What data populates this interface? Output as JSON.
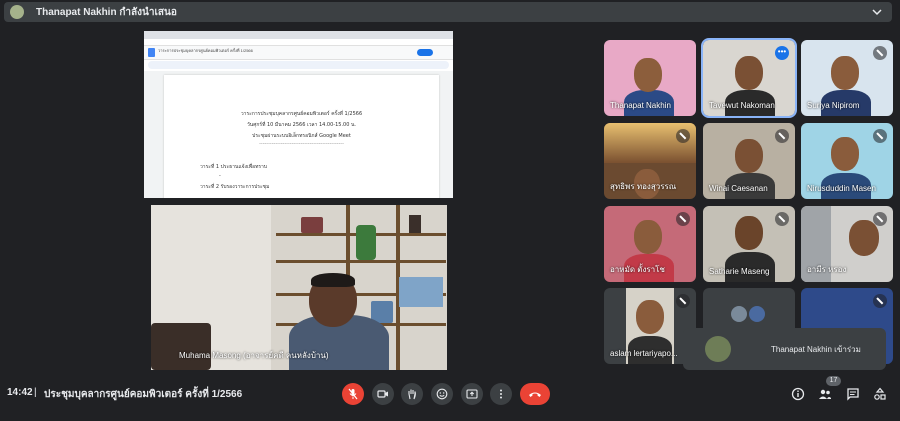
{
  "presenter_banner": {
    "text": "Thanapat Nakhin กำลังนำเสนอ"
  },
  "shared_doc": {
    "tab_title": "วาระการประชุมบุคลากรศูนย์คอมพิวเตอร์ ครั้งที่ 1/2566",
    "heading": "วาระการประชุมบุคลากรศูนย์คอมพิวเตอร์ ครั้งที่ 1/2566",
    "date_line": "วันศุกร์ที่ 10 มีนาคม 2566 เวลา 14.00-15.00 น.",
    "venue_line": "ประชุมผ่านระบบอิเล็กทรอนิกส์ Google Meet",
    "divider": "-----------------------------------------------",
    "agenda_1": "วาระที่ 1 ประธานแจ้งเพื่อทราบ",
    "agenda_1_sub": "-",
    "agenda_2": "วาระที่ 2 รับรองวาระการประชุม"
  },
  "main_speaker": {
    "name": "Muhama Masong (อาจารย์คดี คนหลังบ้าน)"
  },
  "participants": [
    {
      "name": "Thanapat Nakhin"
    },
    {
      "name": "Tavewut Nakoman"
    },
    {
      "name": "Suriya Nipirom"
    },
    {
      "name": "สุทธิพร ทองสุวรรณ"
    },
    {
      "name": "Winai Caesanan"
    },
    {
      "name": "Nirusduddin Masen"
    },
    {
      "name": "อาหมัด ตั้งราโช"
    },
    {
      "name": "Satharie Maseng"
    },
    {
      "name": "อามีร หรอง"
    },
    {
      "name": "aslam lertariyapo..."
    },
    {
      "name": ""
    },
    {
      "name": ""
    }
  ],
  "toast": {
    "text": "Thanapat Nakhin เข้าร่วม"
  },
  "bottom_bar": {
    "time": "14:42",
    "separator": "|",
    "meeting_title": "ประชุมบุคลากรศูนย์คอมพิวเตอร์ ครั้งที่ 1/2566",
    "participant_count": "17"
  },
  "colors": {
    "background": "#202124",
    "panel": "#3c4043",
    "danger": "#ea4335",
    "accent": "#8ab4f8"
  }
}
